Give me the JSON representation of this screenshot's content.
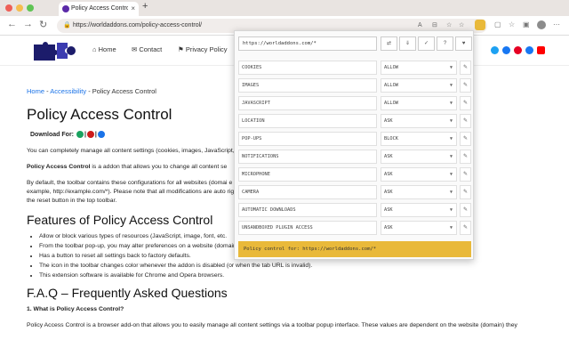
{
  "browser": {
    "tab_title": "Policy Access Control - World",
    "tab_close": "×",
    "new_tab": "+",
    "url": "https://worldaddons.com/policy-access-control/",
    "nav_back": "←",
    "nav_forward": "→",
    "nav_reload": "↻"
  },
  "site": {
    "nav": [
      "Home",
      "Contact",
      "Privacy Policy"
    ],
    "social_colors": [
      "#1da1f2",
      "#1877f2",
      "#e60023",
      "#1877f2",
      "#ff0000"
    ]
  },
  "page": {
    "breadcrumb": {
      "home": "Home",
      "sep": " - ",
      "section": "Accessibility",
      "current": "Policy Access Control"
    },
    "title": "Policy Access Control",
    "download_label": "Download For:",
    "para1": "You can completely manage all content settings (cookies, images, JavaScript,",
    "para2_strong": "Policy Access Control",
    "para2_rest": " is a addon that allows you to change all content se",
    "para3a": "By default, the toolbar contains these configurations for all websites (domai                                                                                      e toolbar popup UI (for",
    "para3b": "example, http://example.com/*). Please note that all modifications are auto                                                                                          riginal settings, click",
    "para3c": "the reset button in the top toolbar.",
    "features_heading": "Features of Policy Access Control",
    "features": [
      "Allow or block various types of resources (JavaScript, image, font, etc.",
      "From the toolbar pop-up, you may alter preferences on a website (domain) basis.",
      "Has a button to reset all settings back to factory defaults.",
      "The icon in the toolbar changes color whenever the addon is disabled (or when the tab URL is invalid).",
      "This extension software is available for Chrome and Opera browsers."
    ],
    "faq_heading": "F.A.Q – Frequently Asked Questions",
    "faq_q1": "1. What is Policy Access Control?",
    "faq_a1": "Policy Access Control is a browser add-on that allows you to easily manage all content settings via a toolbar popup interface. These values are dependent on the website (domain) they"
  },
  "popup": {
    "url_value": "https://worldaddons.com/*",
    "buttons": [
      "⇄",
      "⇓",
      "✓",
      "?",
      "♥"
    ],
    "edit_glyph": "✎",
    "rows": [
      {
        "label": "COOKIES",
        "value": "ALLOW"
      },
      {
        "label": "IMAGES",
        "value": "ALLOW"
      },
      {
        "label": "JAVASCRIPT",
        "value": "ALLOW"
      },
      {
        "label": "LOCATION",
        "value": "ASK"
      },
      {
        "label": "POP-UPS",
        "value": "BLOCK"
      },
      {
        "label": "NOTIFICATIONS",
        "value": "ASK"
      },
      {
        "label": "MICROPHONE",
        "value": "ASK"
      },
      {
        "label": "CAMERA",
        "value": "ASK"
      },
      {
        "label": "AUTOMATIC DOWNLOADS",
        "value": "ASK"
      },
      {
        "label": "UNSANDBOXED PLUGIN ACCESS",
        "value": "ASK"
      }
    ],
    "status": "Policy control for: https://worldaddons.com/*",
    "accent": "#e9b93a"
  }
}
